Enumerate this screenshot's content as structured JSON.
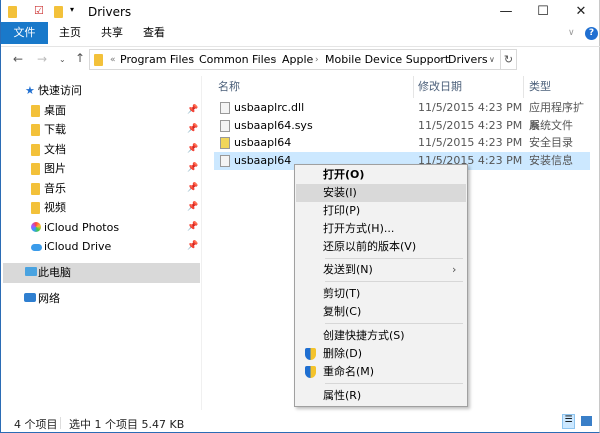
{
  "window": {
    "title": "Drivers",
    "minimize": "—",
    "maximize": "☐",
    "close": "✕"
  },
  "ribbon": {
    "tabs": [
      "文件",
      "主页",
      "共享",
      "查看"
    ],
    "help": "?"
  },
  "address": {
    "crumbs": [
      "Program Files",
      "Common Files",
      "Apple",
      "Mobile Device Support",
      "Drivers"
    ]
  },
  "nav": {
    "items": [
      {
        "label": "快速访问",
        "icon": "star-icon"
      },
      {
        "label": "桌面",
        "icon": "desktop-folder-icon",
        "pinned": true
      },
      {
        "label": "下载",
        "icon": "download-folder-icon",
        "pinned": true
      },
      {
        "label": "文档",
        "icon": "documents-folder-icon",
        "pinned": true
      },
      {
        "label": "图片",
        "icon": "pictures-folder-icon",
        "pinned": true
      },
      {
        "label": "音乐",
        "icon": "music-folder-icon",
        "pinned": true
      },
      {
        "label": "视频",
        "icon": "video-folder-icon",
        "pinned": true
      },
      {
        "label": "iCloud Photos",
        "icon": "icloud-photos-icon",
        "pinned": true
      },
      {
        "label": "iCloud Drive",
        "icon": "icloud-drive-icon",
        "pinned": true
      },
      {
        "label": "此电脑",
        "icon": "computer-icon"
      },
      {
        "label": "网络",
        "icon": "network-icon"
      }
    ]
  },
  "columns": [
    "名称",
    "修改日期",
    "类型"
  ],
  "files": [
    {
      "name": "usbaaplrc.dll",
      "date": "11/5/2015 4:23 PM",
      "type": "应用程序扩展"
    },
    {
      "name": "usbaapl64.sys",
      "date": "11/5/2015 4:23 PM",
      "type": "系统文件"
    },
    {
      "name": "usbaapl64",
      "date": "11/5/2015 4:23 PM",
      "type": "安全目录"
    },
    {
      "name": "usbaapl64",
      "date": "11/5/2015 4:23 PM",
      "type": "安装信息"
    }
  ],
  "context_menu": [
    "打开(O)",
    "安装(I)",
    "打印(P)",
    "打开方式(H)...",
    "还原以前的版本(V)",
    "发送到(N)",
    "剪切(T)",
    "复制(C)",
    "创建快捷方式(S)",
    "删除(D)",
    "重命名(M)",
    "属性(R)"
  ],
  "status": {
    "count": "4 个项目",
    "selected": "选中 1 个项目  5.47 KB"
  }
}
